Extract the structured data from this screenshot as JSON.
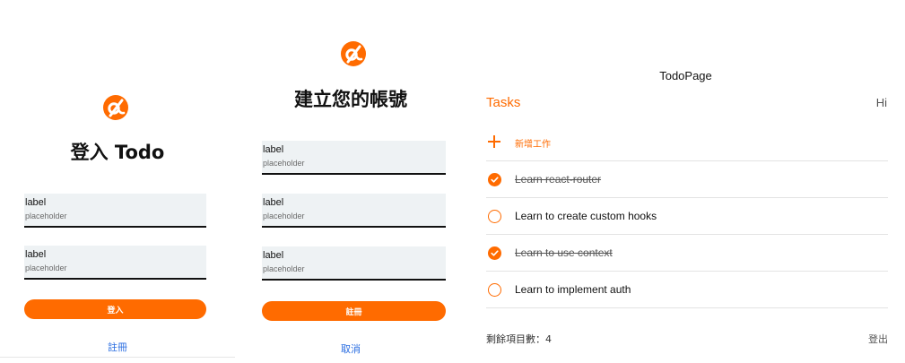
{
  "login": {
    "title": "登入 Todo",
    "fields": [
      {
        "label": "label",
        "placeholder": "placeholder"
      },
      {
        "label": "label",
        "placeholder": "placeholder"
      }
    ],
    "submit_label": "登入",
    "link_label": "註冊"
  },
  "register": {
    "title": "建立您的帳號",
    "fields": [
      {
        "label": "label",
        "placeholder": "placeholder"
      },
      {
        "label": "label",
        "placeholder": "placeholder"
      },
      {
        "label": "label",
        "placeholder": "placeholder"
      }
    ],
    "submit_label": "註冊",
    "link_label": "取消"
  },
  "todo": {
    "page_title": "TodoPage",
    "heading": "Tasks",
    "greeting": "Hi",
    "add_label": "新增工作",
    "tasks": [
      {
        "text": "Learn react-router",
        "done": true
      },
      {
        "text": "Learn to create custom hooks",
        "done": false
      },
      {
        "text": "Learn to use context",
        "done": true
      },
      {
        "text": "Learn to implement auth",
        "done": false
      }
    ],
    "remaining_text": "剩餘項目數：4",
    "logout_label": "登出"
  },
  "colors": {
    "accent": "#ff6b00",
    "link": "#2a6de1",
    "field_bg": "#eef2f4"
  },
  "icons": {
    "logo": "brand-logo-icon",
    "add": "plus-icon",
    "checked": "checkmark-circle-icon",
    "unchecked": "empty-circle-icon"
  }
}
